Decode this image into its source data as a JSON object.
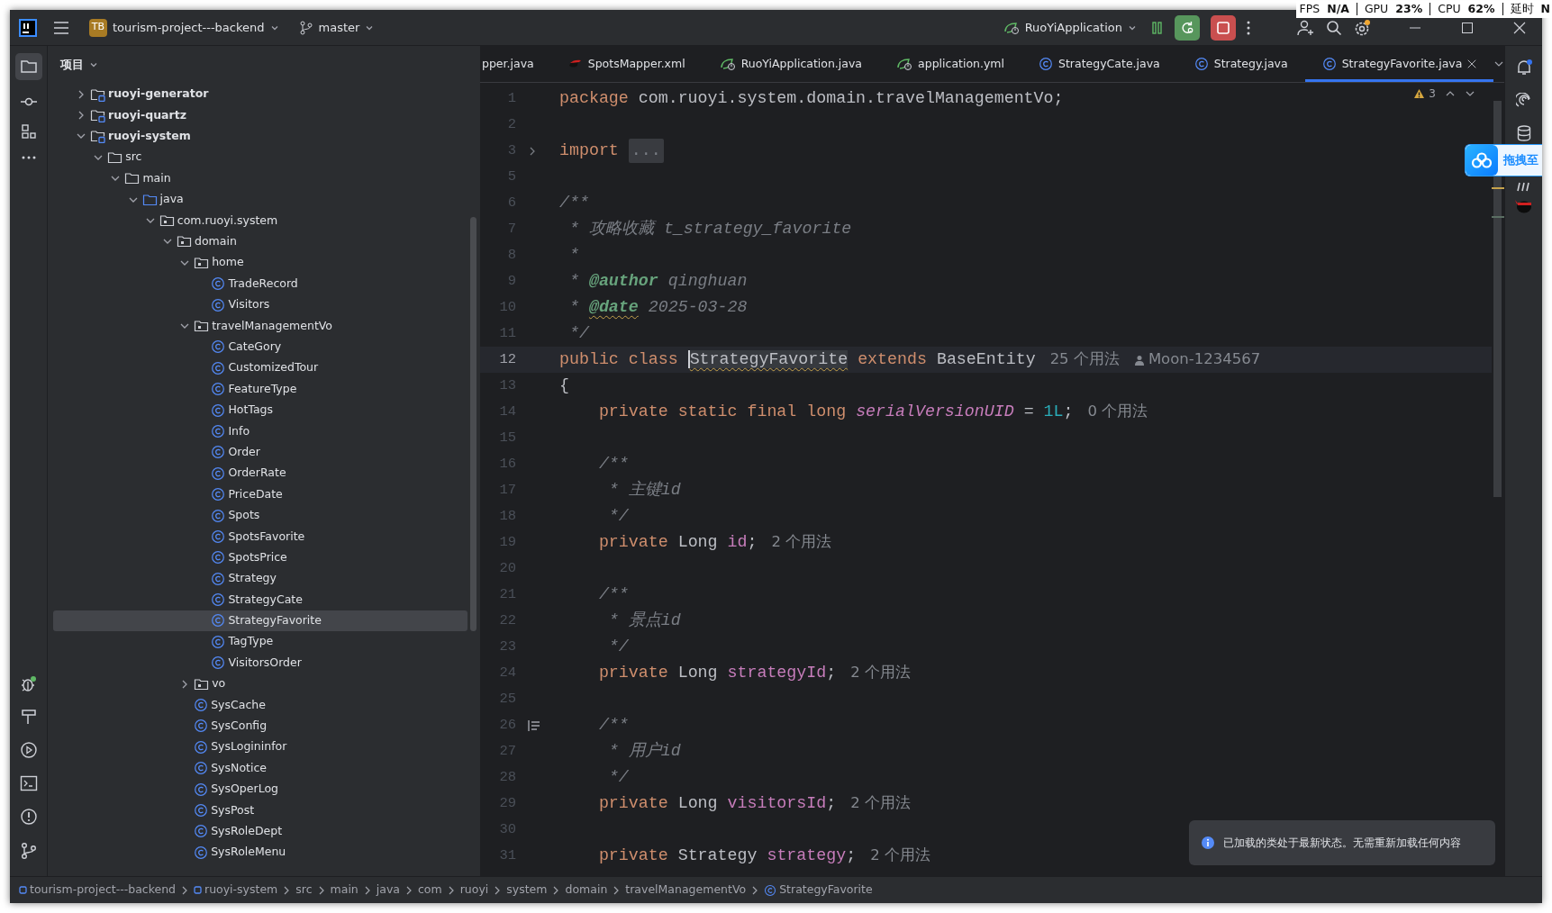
{
  "title_bar": {
    "project_badge": "TB",
    "project_name": "tourism-project---backend",
    "branch": "master",
    "run_config": "RuoYiApplication"
  },
  "performance_overlay": [
    {
      "label": "FPS",
      "value": "N/A"
    },
    {
      "label": "GPU",
      "value": "23%"
    },
    {
      "label": "CPU",
      "value": "62%"
    },
    {
      "label": "延时",
      "value": "N"
    }
  ],
  "project_panel": {
    "title": "项目",
    "tree": [
      {
        "label": "ruoyi-generator",
        "kind": "module",
        "expanded": false,
        "selected": false
      },
      {
        "label": "ruoyi-quartz",
        "kind": "module",
        "expanded": false,
        "selected": false
      },
      {
        "label": "ruoyi-system",
        "kind": "module",
        "expanded": true,
        "selected": false,
        "children": [
          {
            "label": "src",
            "kind": "folder",
            "expanded": true,
            "selected": false,
            "children": [
              {
                "label": "main",
                "kind": "folder",
                "expanded": true,
                "selected": false,
                "children": [
                  {
                    "label": "java",
                    "kind": "source",
                    "expanded": true,
                    "selected": false,
                    "children": [
                      {
                        "label": "com.ruoyi.system",
                        "kind": "package",
                        "expanded": true,
                        "selected": false,
                        "children": [
                          {
                            "label": "domain",
                            "kind": "package",
                            "expanded": true,
                            "selected": false,
                            "children": [
                              {
                                "label": "home",
                                "kind": "package",
                                "expanded": true,
                                "selected": false,
                                "children": [
                                  {
                                    "label": "TradeRecord",
                                    "kind": "class",
                                    "selected": false
                                  },
                                  {
                                    "label": "Visitors",
                                    "kind": "class",
                                    "selected": false
                                  }
                                ]
                              },
                              {
                                "label": "travelManagementVo",
                                "kind": "package",
                                "expanded": true,
                                "selected": false,
                                "children": [
                                  {
                                    "label": "CateGory",
                                    "kind": "class",
                                    "selected": false
                                  },
                                  {
                                    "label": "CustomizedTour",
                                    "kind": "class",
                                    "selected": false
                                  },
                                  {
                                    "label": "FeatureType",
                                    "kind": "class",
                                    "selected": false
                                  },
                                  {
                                    "label": "HotTags",
                                    "kind": "class",
                                    "selected": false
                                  },
                                  {
                                    "label": "Info",
                                    "kind": "class",
                                    "selected": false
                                  },
                                  {
                                    "label": "Order",
                                    "kind": "class",
                                    "selected": false
                                  },
                                  {
                                    "label": "OrderRate",
                                    "kind": "class",
                                    "selected": false
                                  },
                                  {
                                    "label": "PriceDate",
                                    "kind": "class",
                                    "selected": false
                                  },
                                  {
                                    "label": "Spots",
                                    "kind": "class",
                                    "selected": false
                                  },
                                  {
                                    "label": "SpotsFavorite",
                                    "kind": "class",
                                    "selected": false
                                  },
                                  {
                                    "label": "SpotsPrice",
                                    "kind": "class",
                                    "selected": false
                                  },
                                  {
                                    "label": "Strategy",
                                    "kind": "class",
                                    "selected": false
                                  },
                                  {
                                    "label": "StrategyCate",
                                    "kind": "class",
                                    "selected": false
                                  },
                                  {
                                    "label": "StrategyFavorite",
                                    "kind": "class",
                                    "selected": true
                                  },
                                  {
                                    "label": "TagType",
                                    "kind": "class",
                                    "selected": false
                                  },
                                  {
                                    "label": "VisitorsOrder",
                                    "kind": "class",
                                    "selected": false
                                  }
                                ]
                              },
                              {
                                "label": "vo",
                                "kind": "package",
                                "expanded": false,
                                "selected": false
                              },
                              {
                                "label": "SysCache",
                                "kind": "class",
                                "selected": false
                              },
                              {
                                "label": "SysConfig",
                                "kind": "class",
                                "selected": false
                              },
                              {
                                "label": "SysLogininfor",
                                "kind": "class",
                                "selected": false
                              },
                              {
                                "label": "SysNotice",
                                "kind": "class",
                                "selected": false
                              },
                              {
                                "label": "SysOperLog",
                                "kind": "class",
                                "selected": false
                              },
                              {
                                "label": "SysPost",
                                "kind": "class",
                                "selected": false
                              },
                              {
                                "label": "SysRoleDept",
                                "kind": "class",
                                "selected": false
                              },
                              {
                                "label": "SysRoleMenu",
                                "kind": "class",
                                "selected": false
                              }
                            ]
                          }
                        ]
                      }
                    ]
                  }
                ]
              }
            ]
          }
        ]
      }
    ]
  },
  "tabs": [
    {
      "label": "pper.java",
      "kind": "partial",
      "selected": false
    },
    {
      "label": "SpotsMapper.xml",
      "kind": "xml",
      "selected": false
    },
    {
      "label": "RuoYiApplication.java",
      "kind": "application",
      "selected": false
    },
    {
      "label": "application.yml",
      "kind": "config",
      "selected": false
    },
    {
      "label": "StrategyCate.java",
      "kind": "class",
      "selected": false
    },
    {
      "label": "Strategy.java",
      "kind": "class",
      "selected": false
    },
    {
      "label": "StrategyFavorite.java",
      "kind": "class",
      "selected": true
    }
  ],
  "editor": {
    "problems": "3",
    "lines": [
      {
        "number": "1",
        "current": false,
        "tokens": [
          {
            "kind": "kw",
            "text": "package"
          },
          {
            "kind": "plain",
            "text": " com.ruoyi.system.domain.travelManagementVo;"
          }
        ]
      },
      {
        "number": "2",
        "current": false
      },
      {
        "number": "3",
        "current": false,
        "kind": "folded",
        "tokens": [
          {
            "kind": "kw",
            "text": "import "
          },
          {
            "kind": "folded",
            "text": "..."
          }
        ]
      },
      {
        "number": "5",
        "current": false
      },
      {
        "number": "6",
        "current": false,
        "tokens": [
          {
            "kind": "comment",
            "text": "/**"
          }
        ]
      },
      {
        "number": "7",
        "current": false,
        "tokens": [
          {
            "kind": "comment",
            "text": " * 攻略收藏 t_strategy_favorite"
          }
        ]
      },
      {
        "number": "8",
        "current": false,
        "tokens": [
          {
            "kind": "comment",
            "text": " *"
          }
        ]
      },
      {
        "number": "9",
        "current": false,
        "tokens": [
          {
            "kind": "comment",
            "text": " * "
          },
          {
            "kind": "doctag",
            "text": "@author",
            "warning": false
          },
          {
            "kind": "comment",
            "text": " qinghuan"
          }
        ]
      },
      {
        "number": "10",
        "current": false,
        "tokens": [
          {
            "kind": "comment",
            "text": " * "
          },
          {
            "kind": "doctag",
            "text": "@date",
            "warning": true
          },
          {
            "kind": "comment",
            "text": " 2025-03-28"
          }
        ]
      },
      {
        "number": "11",
        "current": false,
        "tokens": [
          {
            "kind": "comment",
            "text": " */"
          }
        ]
      },
      {
        "number": "12",
        "current": true,
        "tokens": [
          {
            "kind": "kw",
            "text": "public class "
          },
          {
            "kind": "cls",
            "text": "StrategyFavorite",
            "warning": true,
            "cursor": true
          },
          {
            "kind": "kw",
            "text": " extends "
          },
          {
            "kind": "plain",
            "text": "BaseEntity"
          },
          {
            "kind": "hint",
            "text": "25 个用法"
          },
          {
            "kind": "author",
            "text": "Moon-1234567"
          }
        ]
      },
      {
        "number": "13",
        "current": false,
        "tokens": [
          {
            "kind": "plain",
            "text": "{"
          }
        ]
      },
      {
        "number": "14",
        "current": false,
        "tokens": [
          {
            "kind": "kw",
            "text": "    private static final long "
          },
          {
            "kind": "static",
            "text": "serialVersionUID"
          },
          {
            "kind": "plain",
            "text": " = "
          },
          {
            "kind": "num",
            "text": "1L"
          },
          {
            "kind": "plain",
            "text": ";"
          },
          {
            "kind": "hint",
            "text": "0 个用法"
          }
        ]
      },
      {
        "number": "15",
        "current": false
      },
      {
        "number": "16",
        "current": false,
        "tokens": [
          {
            "kind": "comment",
            "text": "    /**"
          }
        ]
      },
      {
        "number": "17",
        "current": false,
        "tokens": [
          {
            "kind": "comment",
            "text": "     * 主键id"
          }
        ]
      },
      {
        "number": "18",
        "current": false,
        "tokens": [
          {
            "kind": "comment",
            "text": "     */"
          }
        ]
      },
      {
        "number": "19",
        "current": false,
        "tokens": [
          {
            "kind": "kw",
            "text": "    private "
          },
          {
            "kind": "plain",
            "text": "Long "
          },
          {
            "kind": "field",
            "text": "id"
          },
          {
            "kind": "plain",
            "text": ";"
          },
          {
            "kind": "hint",
            "text": "2 个用法"
          }
        ]
      },
      {
        "number": "20",
        "current": false
      },
      {
        "number": "21",
        "current": false,
        "tokens": [
          {
            "kind": "comment",
            "text": "    /**"
          }
        ]
      },
      {
        "number": "22",
        "current": false,
        "tokens": [
          {
            "kind": "comment",
            "text": "     * 景点id"
          }
        ]
      },
      {
        "number": "23",
        "current": false,
        "tokens": [
          {
            "kind": "comment",
            "text": "     */"
          }
        ]
      },
      {
        "number": "24",
        "current": false,
        "tokens": [
          {
            "kind": "kw",
            "text": "    private "
          },
          {
            "kind": "plain",
            "text": "Long "
          },
          {
            "kind": "field",
            "text": "strategyId"
          },
          {
            "kind": "plain",
            "text": ";"
          },
          {
            "kind": "hint",
            "text": "2 个用法"
          }
        ]
      },
      {
        "number": "25",
        "current": false
      },
      {
        "number": "26",
        "current": false,
        "kind": "doc-comment",
        "tokens": [
          {
            "kind": "comment",
            "text": "    /**"
          }
        ]
      },
      {
        "number": "27",
        "current": false,
        "tokens": [
          {
            "kind": "comment",
            "text": "     * 用户id"
          }
        ]
      },
      {
        "number": "28",
        "current": false,
        "tokens": [
          {
            "kind": "comment",
            "text": "     */"
          }
        ]
      },
      {
        "number": "29",
        "current": false,
        "tokens": [
          {
            "kind": "kw",
            "text": "    private "
          },
          {
            "kind": "plain",
            "text": "Long "
          },
          {
            "kind": "field",
            "text": "visitorsId"
          },
          {
            "kind": "plain",
            "text": ";"
          },
          {
            "kind": "hint",
            "text": "2 个用法"
          }
        ]
      },
      {
        "number": "30",
        "current": false
      },
      {
        "number": "31",
        "current": false,
        "tokens": [
          {
            "kind": "kw",
            "text": "    private "
          },
          {
            "kind": "plain",
            "text": "Strategy "
          },
          {
            "kind": "field",
            "text": "strategy"
          },
          {
            "kind": "plain",
            "text": ";"
          },
          {
            "kind": "hint",
            "text": "2 个用法"
          }
        ]
      }
    ]
  },
  "floating_widget": {
    "label": "拖拽至"
  },
  "notification": {
    "text": "已加载的类处于最新状态。无需重新加载任何内容"
  },
  "breadcrumbs": [
    {
      "label": "tourism-project---backend",
      "kind": "module"
    },
    {
      "label": "ruoyi-system",
      "kind": "module"
    },
    {
      "label": "src",
      "kind": "folder"
    },
    {
      "label": "main",
      "kind": "folder"
    },
    {
      "label": "java",
      "kind": "folder"
    },
    {
      "label": "com",
      "kind": "folder"
    },
    {
      "label": "ruoyi",
      "kind": "folder"
    },
    {
      "label": "system",
      "kind": "folder"
    },
    {
      "label": "domain",
      "kind": "folder"
    },
    {
      "label": "travelManagementVo",
      "kind": "folder"
    },
    {
      "label": "StrategyFavorite",
      "kind": "class"
    }
  ]
}
